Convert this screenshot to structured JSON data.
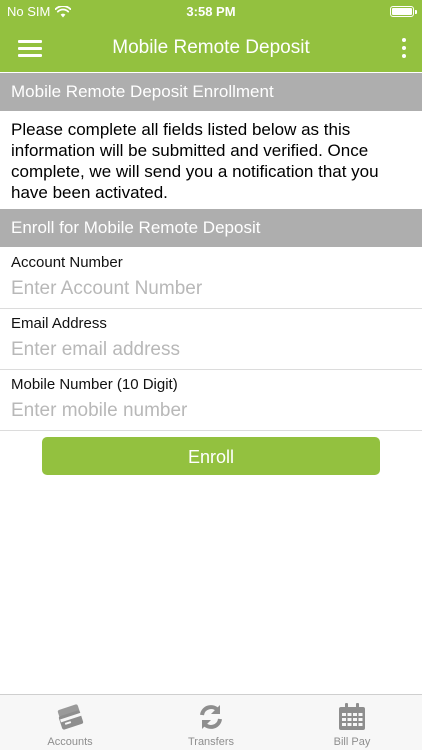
{
  "status_bar": {
    "carrier": "No SIM",
    "time": "3:58 PM"
  },
  "navbar": {
    "title": "Mobile Remote Deposit",
    "menu_icon": "hamburger-menu-icon",
    "more_icon": "more-vertical-icon"
  },
  "enrollment": {
    "header": "Mobile Remote Deposit Enrollment",
    "instructions": "Please complete all fields listed below as this information will be submitted and verified.  Once complete, we will send you a notification that you have been activated."
  },
  "form": {
    "header": "Enroll for Mobile Remote Deposit",
    "fields": [
      {
        "label": "Account Number",
        "value": "",
        "placeholder": "Enter Account Number"
      },
      {
        "label": "Email Address",
        "value": "",
        "placeholder": "Enter email address"
      },
      {
        "label": "Mobile Number (10 Digit)",
        "value": "",
        "placeholder": "Enter mobile number"
      }
    ],
    "submit_label": "Enroll"
  },
  "tabbar": {
    "tabs": [
      {
        "label": "Accounts",
        "icon": "credit-cards-icon"
      },
      {
        "label": "Transfers",
        "icon": "refresh-arrows-icon"
      },
      {
        "label": "Bill Pay",
        "icon": "calendar-icon"
      }
    ]
  },
  "colors": {
    "brand_green": "#93c13f",
    "section_gray": "#aeaeae",
    "tab_icon_gray": "#8e8e8e"
  }
}
